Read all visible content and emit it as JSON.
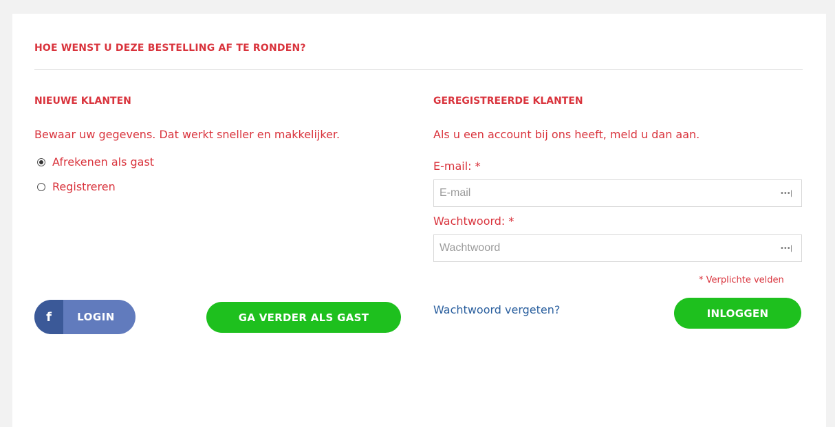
{
  "page": {
    "title": "HOE WENST U DEZE BESTELLING AF TE RONDEN?"
  },
  "new_customers": {
    "heading": "NIEUWE KLANTEN",
    "intro": "Bewaar uw gegevens. Dat werkt sneller en makkelijker.",
    "options": [
      {
        "label": "Afrekenen als gast",
        "checked": true
      },
      {
        "label": "Registreren",
        "checked": false
      }
    ],
    "facebook_icon": "f",
    "facebook_login_label": "LOGIN",
    "guest_button_label": "GA VERDER ALS GAST"
  },
  "registered_customers": {
    "heading": "GEREGISTREERDE KLANTEN",
    "intro": "Als u een account bij ons heeft, meld u dan aan.",
    "email_label": "E-mail: *",
    "email_placeholder": "E-mail",
    "email_value": "",
    "password_label": "Wachtwoord: *",
    "password_placeholder": "Wachtwoord",
    "password_value": "",
    "password_manager_icon": "•••|",
    "required_note": "* Verplichte velden",
    "forgot_link": "Wachtwoord vergeten?",
    "login_button_label": "INLOGGEN"
  },
  "colors": {
    "accent_red": "#d9333c",
    "button_green": "#1ec01e",
    "facebook_blue": "#3b5998",
    "link_blue": "#2a5f9e"
  }
}
